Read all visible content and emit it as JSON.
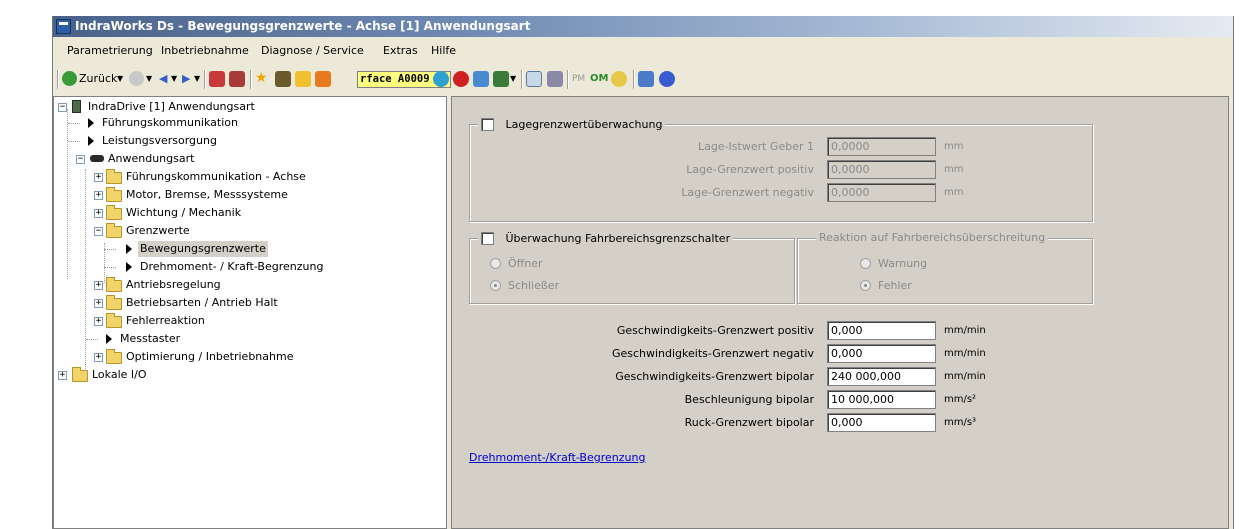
{
  "window": {
    "title": "IndraWorks Ds - Bewegungsgrenzwerte - Achse [1] Anwendungsart"
  },
  "menu": [
    "Parametrierung",
    "Inbetriebnahme",
    "Diagnose / Service",
    "Extras",
    "Hilfe"
  ],
  "toolbar": {
    "back_label": "Zurück",
    "address_text": "rface  A0009 A",
    "pm_label": "PM",
    "om_label": "OM"
  },
  "tree": {
    "root": "IndraDrive [1] Anwendungsart",
    "items": [
      "Führungskommunikation",
      "Leistungsversorgung",
      "Anwendungsart",
      "Führungskommunikation - Achse",
      "Motor, Bremse, Messsysteme",
      "Wichtung / Mechanik",
      "Grenzwerte",
      "Bewegungsgrenzwerte",
      "Drehmoment- / Kraft-Begrenzung",
      "Antriebsregelung",
      "Betriebsarten / Antrieb Halt",
      "Fehlerreaktion",
      "Messtaster",
      "Optimierung / Inbetriebnahme",
      "Lokale I/O"
    ],
    "selected": "Bewegungsgrenzwerte"
  },
  "lage": {
    "title": "Lagegrenzwertüberwachung",
    "checked": false,
    "rows": [
      {
        "label": "Lage-Istwert Geber 1",
        "value": "0,0000",
        "unit": "mm"
      },
      {
        "label": "Lage-Grenzwert positiv",
        "value": "0,0000",
        "unit": "mm"
      },
      {
        "label": "Lage-Grenzwert negativ",
        "value": "0,0000",
        "unit": "mm"
      }
    ]
  },
  "fahrbereich": {
    "title": "Überwachung Fahrbereichsgrenzschalter",
    "checked": false,
    "opt1": "Öffner",
    "opt2": "Schließer",
    "selected": "Schließer"
  },
  "reaktion": {
    "title": "Reaktion auf Fahrbereichsüberschreitung",
    "opt1": "Warnung",
    "opt2": "Fehler",
    "selected": "Fehler"
  },
  "limits": [
    {
      "label": "Geschwindigkeits-Grenzwert positiv",
      "value": "0,000",
      "unit": "mm/min"
    },
    {
      "label": "Geschwindigkeits-Grenzwert negativ",
      "value": "0,000",
      "unit": "mm/min"
    },
    {
      "label": "Geschwindigkeits-Grenzwert bipolar",
      "value": "240 000,000",
      "unit": "mm/min"
    },
    {
      "label": "Beschleunigung bipolar",
      "value": "10 000,000",
      "unit": "mm/s²"
    },
    {
      "label": "Ruck-Grenzwert bipolar",
      "value": "0,000",
      "unit": "mm/s³"
    }
  ],
  "link": "Drehmoment-/Kraft-Begrenzung"
}
